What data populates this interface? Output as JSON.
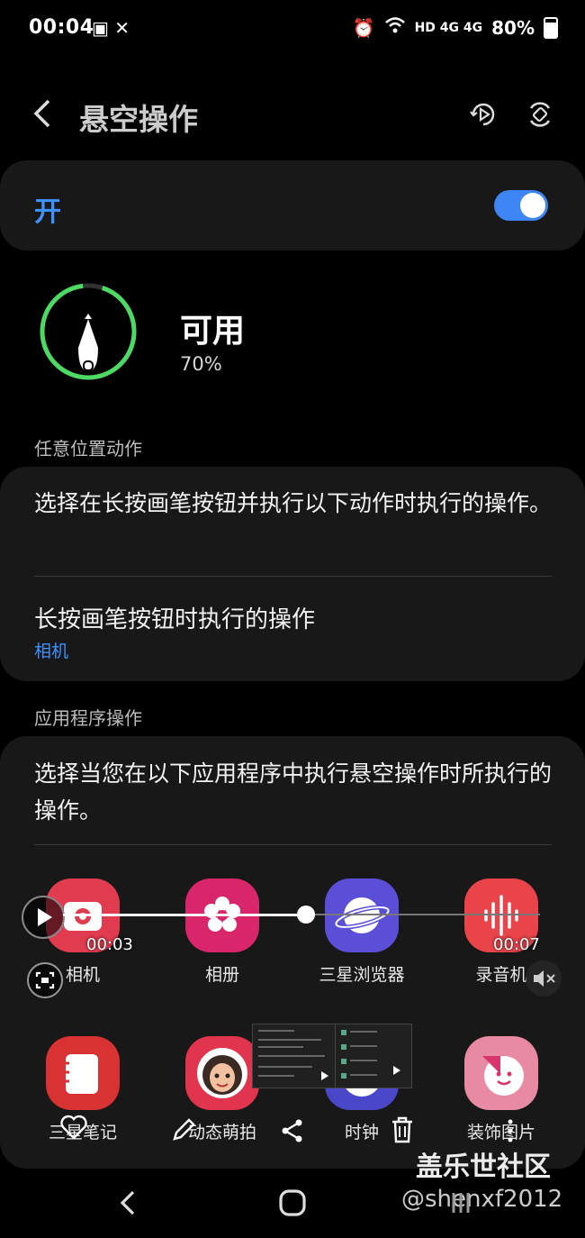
{
  "status_bar": {
    "time": "00:04",
    "left_icons": "▣ ✕",
    "network": "HD 4G 4G",
    "battery": "80%"
  },
  "header": {
    "back_icon": "chevron-left-icon",
    "title": "悬空操作",
    "icons": [
      "play-rotate-icon",
      "auto-rotate-icon"
    ]
  },
  "toggle": {
    "label": "开",
    "on": true,
    "accent": "#3f86f5"
  },
  "pen_status": {
    "label": "可用",
    "battery": "70%",
    "level": 0.7,
    "ring_color": "#4cd964"
  },
  "anywhere_actions": {
    "section_title": "任意位置动作",
    "description": "选择在长按画笔按钮并执行以下动作时执行的操作。",
    "item_title": "长按画笔按钮时执行的操作",
    "item_value": "相机"
  },
  "app_actions": {
    "section_title": "应用程序操作",
    "description": "选择当您在以下应用程序中执行悬空操作时所执行的操作。",
    "apps_row1": [
      {
        "label": "相机",
        "color": "#e03b4e",
        "icon": "camera-icon"
      },
      {
        "label": "相册",
        "color": "#d9266a",
        "icon": "flower-icon"
      },
      {
        "label": "三星浏览器",
        "color": "#5a4fd6",
        "icon": "planet-icon"
      },
      {
        "label": "录音机",
        "color": "#e8444a",
        "icon": "waveform-icon"
      }
    ],
    "apps_row2": [
      {
        "label": "三星笔记",
        "color": "#d83232",
        "icon": "notes-icon"
      },
      {
        "label": "动态萌拍",
        "color": "#e0354c",
        "icon": "avatar-icon"
      },
      {
        "label": "时钟",
        "color": "#4a47c9",
        "icon": "clock-icon"
      },
      {
        "label": "装饰图片",
        "color": "#e98aa4",
        "icon": "sticker-icon"
      }
    ]
  },
  "video_overlay": {
    "current_time": "00:03",
    "total_time": "00:07",
    "progress": 0.43
  },
  "watermark": {
    "line1": "盖乐世社区",
    "line2": "@shenxf2012"
  }
}
